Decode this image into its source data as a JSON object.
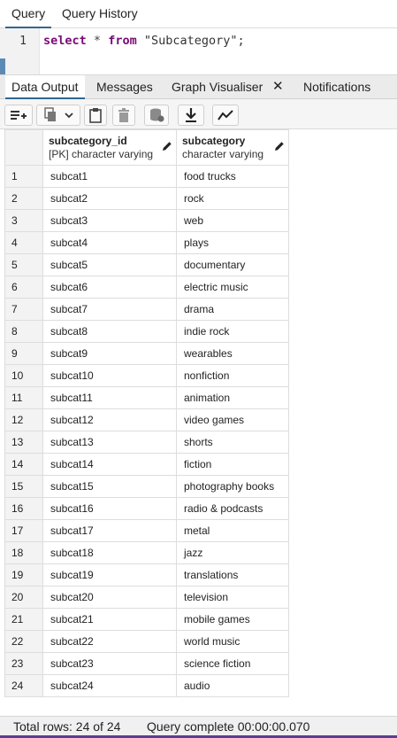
{
  "top_tabs": {
    "query": "Query",
    "history": "Query History"
  },
  "editor": {
    "line_number": "1",
    "kw_select": "select",
    "star": "*",
    "kw_from": "from",
    "table": "\"Subcategory\";"
  },
  "result_tabs": {
    "data_output": "Data Output",
    "messages": "Messages",
    "graph": "Graph Visualiser",
    "close": "✕",
    "notifications": "Notifications"
  },
  "toolbar_icons": [
    "add-row-icon",
    "copy-icon",
    "chevron-down-icon",
    "paste-icon",
    "delete-icon",
    "save-data-icon",
    "download-icon",
    "graph-icon"
  ],
  "columns": [
    {
      "name": "subcategory_id",
      "type": "[PK] character varying"
    },
    {
      "name": "subcategory",
      "type": "character varying"
    }
  ],
  "rows": [
    [
      "1",
      "subcat1",
      "food trucks"
    ],
    [
      "2",
      "subcat2",
      "rock"
    ],
    [
      "3",
      "subcat3",
      "web"
    ],
    [
      "4",
      "subcat4",
      "plays"
    ],
    [
      "5",
      "subcat5",
      "documentary"
    ],
    [
      "6",
      "subcat6",
      "electric music"
    ],
    [
      "7",
      "subcat7",
      "drama"
    ],
    [
      "8",
      "subcat8",
      "indie rock"
    ],
    [
      "9",
      "subcat9",
      "wearables"
    ],
    [
      "10",
      "subcat10",
      "nonfiction"
    ],
    [
      "11",
      "subcat11",
      "animation"
    ],
    [
      "12",
      "subcat12",
      "video games"
    ],
    [
      "13",
      "subcat13",
      "shorts"
    ],
    [
      "14",
      "subcat14",
      "fiction"
    ],
    [
      "15",
      "subcat15",
      "photography books"
    ],
    [
      "16",
      "subcat16",
      "radio & podcasts"
    ],
    [
      "17",
      "subcat17",
      "metal"
    ],
    [
      "18",
      "subcat18",
      "jazz"
    ],
    [
      "19",
      "subcat19",
      "translations"
    ],
    [
      "20",
      "subcat20",
      "television"
    ],
    [
      "21",
      "subcat21",
      "mobile games"
    ],
    [
      "22",
      "subcat22",
      "world music"
    ],
    [
      "23",
      "subcat23",
      "science fiction"
    ],
    [
      "24",
      "subcat24",
      "audio"
    ]
  ],
  "status": {
    "total_rows": "Total rows: 24 of 24",
    "query_complete": "Query complete 00:00:00.070"
  },
  "colors": {
    "accent": "#326690",
    "keyword": "#7a0a74",
    "status_accent": "#5b3e8f"
  }
}
